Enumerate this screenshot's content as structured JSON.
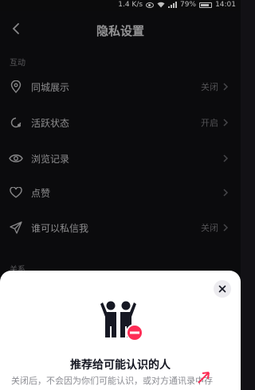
{
  "status_bar": {
    "speed": "1.4 K/s",
    "battery": "79%",
    "time": "14:01"
  },
  "header": {
    "title": "隐私设置"
  },
  "sections": {
    "interaction": "互动",
    "relation": "关系"
  },
  "rows": [
    {
      "label": "同城展示",
      "value": "关闭",
      "icon": "location-pin-icon"
    },
    {
      "label": "活跃状态",
      "value": "开启",
      "icon": "activity-status-icon"
    },
    {
      "label": "浏览记录",
      "value": "",
      "icon": "eye-icon"
    },
    {
      "label": "点赞",
      "value": "",
      "icon": "heart-icon"
    },
    {
      "label": "谁可以私信我",
      "value": "关闭",
      "icon": "send-icon"
    }
  ],
  "sheet": {
    "title": "推荐给可能认识的人",
    "description": "关闭后，不会因为你们可能认识，或对方通讯录中存"
  },
  "colors": {
    "background": "#121115",
    "sheet": "#ffffff",
    "badge": "#fe2c55"
  }
}
